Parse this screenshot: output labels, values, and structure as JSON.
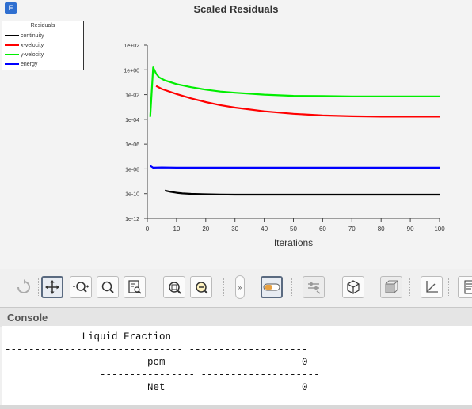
{
  "app_icon_letter": "F",
  "plot_title": "Scaled Residuals",
  "legend": {
    "title": "Residuals",
    "items": [
      {
        "label": "continuity",
        "color": "#000000"
      },
      {
        "label": "x-velocity",
        "color": "#ff0000"
      },
      {
        "label": "y-velocity",
        "color": "#00ee00"
      },
      {
        "label": "energy",
        "color": "#0000ff"
      }
    ]
  },
  "chart_data": {
    "type": "line",
    "title": "Scaled Residuals",
    "xlabel": "Iterations",
    "ylabel": "",
    "xlim": [
      0,
      100
    ],
    "ylim_log10": [
      -12,
      2
    ],
    "yscale": "log",
    "x_ticks": [
      "0",
      "10",
      "20",
      "30",
      "40",
      "50",
      "60",
      "70",
      "80",
      "90",
      "100"
    ],
    "y_ticks": [
      "1e-12",
      "1e-10",
      "1e-08",
      "1e-06",
      "1e-04",
      "1e-02",
      "1e+00",
      "1e+02"
    ],
    "grid": false,
    "legend_position": "top-left",
    "series": [
      {
        "name": "continuity",
        "color": "#000000",
        "x": [
          6,
          8,
          10,
          12,
          15,
          20,
          25,
          30,
          40,
          50,
          60,
          70,
          80,
          90,
          100
        ],
        "log10_y": [
          -9.75,
          -9.85,
          -9.93,
          -9.98,
          -10.02,
          -10.05,
          -10.07,
          -10.08,
          -10.08,
          -10.08,
          -10.08,
          -10.08,
          -10.08,
          -10.08,
          -10.08
        ]
      },
      {
        "name": "x-velocity",
        "color": "#ff0000",
        "x": [
          3,
          5,
          10,
          15,
          20,
          25,
          30,
          40,
          50,
          60,
          70,
          80,
          90,
          100
        ],
        "log10_y": [
          -1.3,
          -1.55,
          -1.95,
          -2.3,
          -2.6,
          -2.85,
          -3.05,
          -3.35,
          -3.55,
          -3.68,
          -3.75,
          -3.78,
          -3.78,
          -3.78
        ]
      },
      {
        "name": "y-velocity",
        "color": "#00ee00",
        "x": [
          1,
          2,
          3,
          4,
          6,
          8,
          10,
          15,
          20,
          25,
          30,
          40,
          50,
          60,
          70,
          80,
          90,
          100
        ],
        "log10_y": [
          -3.8,
          0.2,
          -0.3,
          -0.6,
          -0.85,
          -1.0,
          -1.15,
          -1.4,
          -1.6,
          -1.75,
          -1.85,
          -2.0,
          -2.1,
          -2.12,
          -2.14,
          -2.15,
          -2.15,
          -2.15
        ]
      },
      {
        "name": "energy",
        "color": "#0000ff",
        "x": [
          1,
          2,
          5,
          10,
          20,
          30,
          40,
          50,
          60,
          70,
          80,
          90,
          100
        ],
        "log10_y": [
          -7.75,
          -7.9,
          -7.88,
          -7.9,
          -7.9,
          -7.9,
          -7.9,
          -7.9,
          -7.9,
          -7.9,
          -7.9,
          -7.9,
          -7.9
        ]
      }
    ]
  },
  "toolbar": {
    "buttons": [
      "refresh-icon",
      "pan-icon",
      "zoom-in-icon",
      "zoom-icon",
      "zoom-to-fit-icon",
      "zoom-box-icon",
      "zoom-out-icon",
      "expand-toolbar-icon",
      "probe-icon",
      "options-icon",
      "orientation-cube-icon",
      "view-box-icon",
      "axes-icon",
      "report-icon"
    ]
  },
  "console": {
    "title": "Console",
    "lines": [
      "             Liquid Fraction",
      "------------------------------ --------------------",
      "                        pcm                       0",
      "                ---------------- --------------------",
      "                        Net                       0"
    ]
  }
}
